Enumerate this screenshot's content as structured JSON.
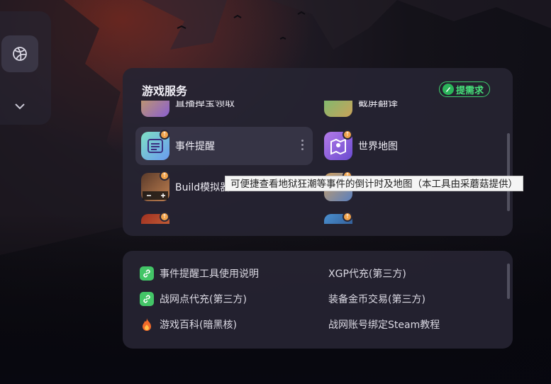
{
  "panel": {
    "title": "游戏服务",
    "request_button": "提需求"
  },
  "tiles": [
    {
      "label": "直播掉宝领取",
      "icon": "live-drop-icon"
    },
    {
      "label": "截屏翻译",
      "icon": "screenshot-translate-icon"
    },
    {
      "label": "事件提醒",
      "icon": "event-reminder-icon"
    },
    {
      "label": "世界地图",
      "icon": "world-map-icon"
    },
    {
      "label": "Build模拟器",
      "icon": "build-simulator-icon"
    },
    {
      "label": "",
      "icon": "app-icon"
    },
    {
      "label": "",
      "icon": "app-icon"
    },
    {
      "label": "",
      "icon": "app-icon"
    }
  ],
  "tooltip": "可便捷查看地狱狂潮等事件的倒计时及地图（本工具由采蘑菇提供）",
  "links": [
    {
      "label": "事件提醒工具使用说明",
      "icon": "link-icon"
    },
    {
      "label": "XGP代充(第三方)",
      "icon": ""
    },
    {
      "label": "战网点代充(第三方)",
      "icon": "link-icon"
    },
    {
      "label": "装备金币交易(第三方)",
      "icon": ""
    },
    {
      "label": "游戏百科(暗黑核)",
      "icon": "fire-icon"
    },
    {
      "label": "战网账号绑定Steam教程",
      "icon": ""
    }
  ],
  "colors": {
    "accent_green": "#47e07a",
    "badge_orange": "#f0a24a",
    "panel_bg": "#262432"
  }
}
